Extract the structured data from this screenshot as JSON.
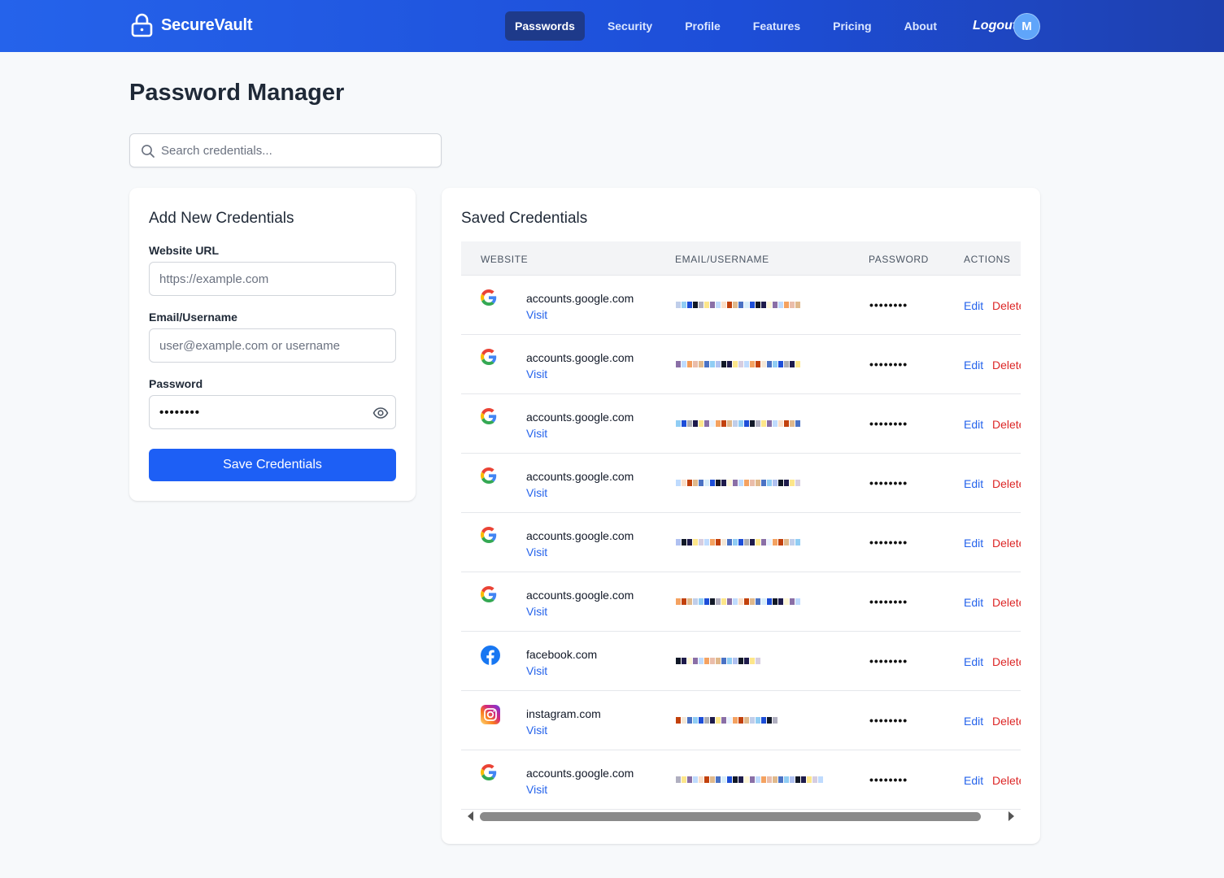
{
  "header": {
    "brand": "SecureVault",
    "nav": [
      {
        "label": "Passwords",
        "active": true
      },
      {
        "label": "Security"
      },
      {
        "label": "Profile"
      },
      {
        "label": "Features"
      },
      {
        "label": "Pricing"
      },
      {
        "label": "About"
      },
      {
        "label": "Logout"
      }
    ],
    "avatar_initial": "M"
  },
  "page_title": "Password Manager",
  "search": {
    "placeholder": "Search credentials..."
  },
  "add_form": {
    "title": "Add New Credentials",
    "url_label": "Website URL",
    "url_placeholder": "https://example.com",
    "user_label": "Email/Username",
    "user_placeholder": "user@example.com or username",
    "password_label": "Password",
    "password_value": "••••••••",
    "save_label": "Save Credentials"
  },
  "saved": {
    "title": "Saved Credentials",
    "columns": [
      "WEBSITE",
      "EMAIL/USERNAME",
      "PASSWORD",
      "ACTIONS"
    ],
    "rows": [
      {
        "site": "accounts.google.com",
        "icon": "google-icon",
        "visit": "Visit",
        "password": "••••••••",
        "edit": "Edit",
        "delete": "Delete"
      },
      {
        "site": "accounts.google.com",
        "icon": "google-icon",
        "visit": "Visit",
        "password": "••••••••",
        "edit": "Edit",
        "delete": "Delete"
      },
      {
        "site": "accounts.google.com",
        "icon": "google-icon",
        "visit": "Visit",
        "password": "••••••••",
        "edit": "Edit",
        "delete": "Delete"
      },
      {
        "site": "accounts.google.com",
        "icon": "google-icon",
        "visit": "Visit",
        "password": "••••••••",
        "edit": "Edit",
        "delete": "Delete"
      },
      {
        "site": "accounts.google.com",
        "icon": "google-icon",
        "visit": "Visit",
        "password": "••••••••",
        "edit": "Edit",
        "delete": "Delete"
      },
      {
        "site": "accounts.google.com",
        "icon": "google-icon",
        "visit": "Visit",
        "password": "••••••••",
        "edit": "Edit",
        "delete": "Delete"
      },
      {
        "site": "facebook.com",
        "icon": "facebook-icon",
        "visit": "Visit",
        "password": "••••••••",
        "edit": "Edit",
        "delete": "Delete"
      },
      {
        "site": "instagram.com",
        "icon": "instagram-icon",
        "visit": "Visit",
        "password": "••••••••",
        "edit": "Edit",
        "delete": "Delete"
      },
      {
        "site": "accounts.google.com",
        "icon": "google-icon",
        "visit": "Visit",
        "password": "••••••••",
        "edit": "Edit",
        "delete": "Delete"
      }
    ]
  },
  "colors": {
    "header_start": "#2563eb",
    "header_end": "#1e40af",
    "primary": "#1d5ff5",
    "link": "#2563eb",
    "danger": "#dc2626"
  }
}
